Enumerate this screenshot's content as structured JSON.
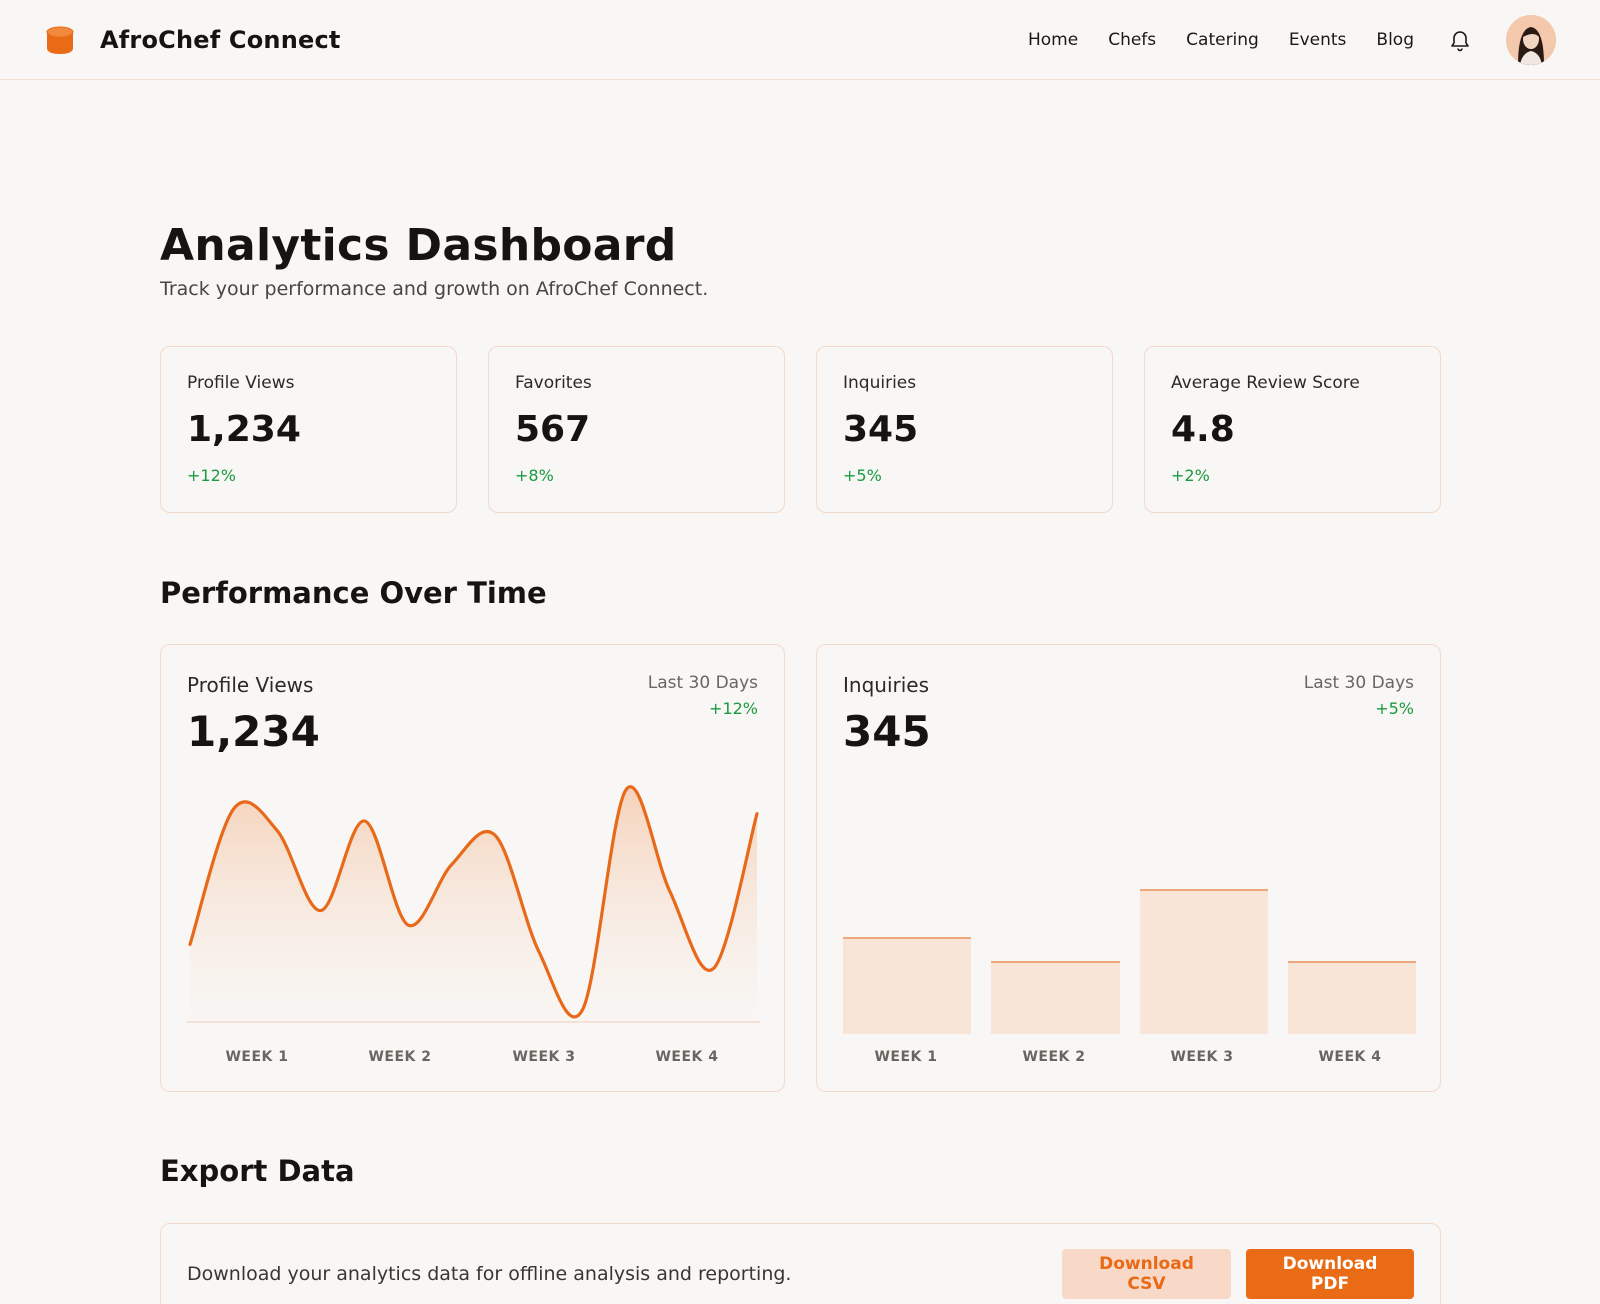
{
  "header": {
    "brand": "AfroChef Connect",
    "nav": [
      "Home",
      "Chefs",
      "Catering",
      "Events",
      "Blog"
    ],
    "icons": {
      "logo": "cylinder-logo-icon",
      "notifications": "bell-icon",
      "profile": "avatar"
    }
  },
  "page": {
    "title": "Analytics Dashboard",
    "subtitle": "Track your performance and growth on AfroChef Connect."
  },
  "stats": [
    {
      "label": "Profile Views",
      "value": "1,234",
      "change": "+12%"
    },
    {
      "label": "Favorites",
      "value": "567",
      "change": "+8%"
    },
    {
      "label": "Inquiries",
      "value": "345",
      "change": "+5%"
    },
    {
      "label": "Average Review Score",
      "value": "4.8",
      "change": "+2%"
    }
  ],
  "performance": {
    "section_title": "Performance Over Time",
    "views_card": {
      "label": "Profile Views",
      "value": "1,234",
      "period": "Last 30 Days",
      "change": "+12%"
    },
    "inquiries_card": {
      "label": "Inquiries",
      "value": "345",
      "period": "Last 30 Days",
      "change": "+5%"
    }
  },
  "chart_data": [
    {
      "type": "area",
      "title": "Profile Views",
      "categories": [
        "WEEK 1",
        "WEEK 2",
        "WEEK 3",
        "WEEK 4"
      ],
      "x": [
        0,
        1,
        2,
        3,
        4,
        5,
        6,
        7,
        8,
        9,
        10,
        11,
        12,
        13,
        14,
        15,
        16,
        17,
        18,
        19
      ],
      "values": [
        30,
        86,
        77,
        44,
        81,
        38,
        63,
        75,
        27,
        3,
        94,
        52,
        20,
        84
      ],
      "ylim": [
        0,
        100
      ],
      "grid": false,
      "color": "#e8691a"
    },
    {
      "type": "bar",
      "title": "Inquiries",
      "categories": [
        "WEEK 1",
        "WEEK 2",
        "WEEK 3",
        "WEEK 4"
      ],
      "values": [
        40,
        30,
        60,
        30
      ],
      "ylim": [
        0,
        100
      ],
      "grid": false,
      "color": "#f9e4d8"
    }
  ],
  "export": {
    "section_title": "Export Data",
    "description": "Download your analytics data for offline analysis and reporting.",
    "csv_label": "Download CSV",
    "pdf_label": "Download PDF"
  },
  "colors": {
    "accent": "#ea6b16",
    "accent_light": "#f8d8c6",
    "positive": "#1a9a3f",
    "border": "#f3d9c9",
    "background": "#f8f7f5"
  }
}
